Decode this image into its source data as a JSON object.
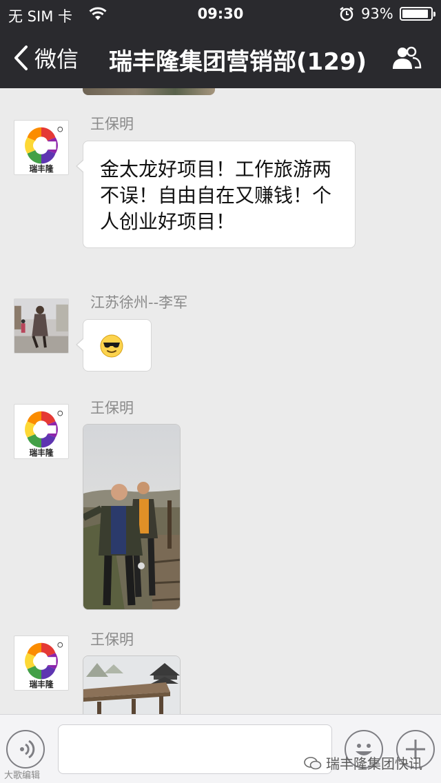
{
  "status_bar": {
    "carrier": "无 SIM 卡",
    "time": "09:30",
    "battery_percent": "93%",
    "battery_level": 0.93,
    "icons": [
      "wifi-icon",
      "alarm-icon",
      "battery-icon"
    ]
  },
  "nav": {
    "back_label": "微信",
    "title": "瑞丰隆集团营销部(129)",
    "right_icon": "group-members-icon"
  },
  "avatar_logo_text": "瑞丰隆",
  "messages": [
    {
      "type": "text",
      "sender": "王保明",
      "avatar": "logo",
      "text": "金太龙好项目！工作旅游两不误！自由自在又赚钱！个人创业好项目！"
    },
    {
      "type": "emoji",
      "sender": "江苏徐州--李军",
      "avatar": "photo",
      "emoji": "sunglasses-emoji-icon"
    },
    {
      "type": "image",
      "sender": "王保明",
      "avatar": "logo",
      "image": "two-men-outdoor-photo"
    },
    {
      "type": "image",
      "sender": "王保明",
      "avatar": "logo",
      "image": "pavilion-photo"
    }
  ],
  "input_bar": {
    "value": "",
    "icons": [
      "voice-icon",
      "emoji-icon",
      "plus-icon"
    ]
  },
  "watermark": {
    "right": "瑞丰隆集团快讯",
    "left": "大歌编辑"
  },
  "colors": {
    "nav_bg": "#2a2a2e",
    "chat_bg": "#ebebeb",
    "bubble_bg": "#ffffff",
    "sender_text": "#8a8a8a"
  }
}
